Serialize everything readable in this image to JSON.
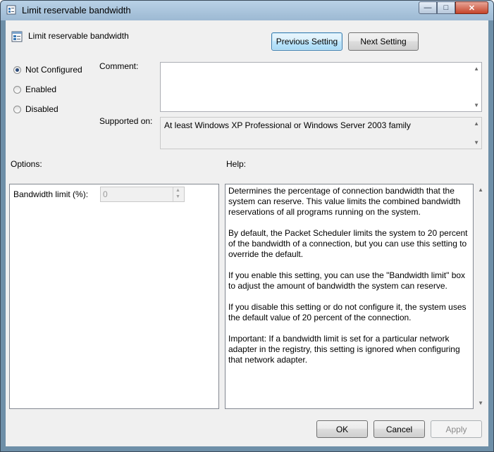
{
  "window": {
    "title": "Limit reservable bandwidth",
    "controls": {
      "minimize": "—",
      "maximize": "□",
      "close": "✕"
    }
  },
  "header": {
    "setting_name": "Limit reservable bandwidth",
    "previous_label": "Previous Setting",
    "next_label": "Next Setting"
  },
  "state": {
    "options": [
      {
        "label": "Not Configured",
        "checked": true
      },
      {
        "label": "Enabled",
        "checked": false
      },
      {
        "label": "Disabled",
        "checked": false
      }
    ]
  },
  "comment": {
    "label": "Comment:",
    "value": ""
  },
  "supported": {
    "label": "Supported on:",
    "value": "At least Windows XP Professional or Windows Server 2003 family"
  },
  "options_section": {
    "label": "Options:",
    "bandwidth_label": "Bandwidth limit (%):",
    "bandwidth_value": "0"
  },
  "help": {
    "label": "Help:",
    "paragraphs": [
      "Determines the percentage of connection bandwidth that the system can reserve. This value limits the combined bandwidth reservations of all programs running on the system.",
      "By default, the Packet Scheduler limits the system to 20 percent of the bandwidth of a connection, but you can use this setting to override the default.",
      "If you enable this setting, you can use the \"Bandwidth limit\" box to adjust the amount of bandwidth the system can reserve.",
      "If you disable this setting or do not configure it, the system uses the default value of 20 percent of the connection.",
      "Important: If a bandwidth limit is set for a particular network adapter in the registry, this setting is ignored when configuring that network adapter."
    ]
  },
  "footer": {
    "ok_label": "OK",
    "cancel_label": "Cancel",
    "apply_label": "Apply"
  },
  "scroll": {
    "up": "▲",
    "down": "▼"
  }
}
